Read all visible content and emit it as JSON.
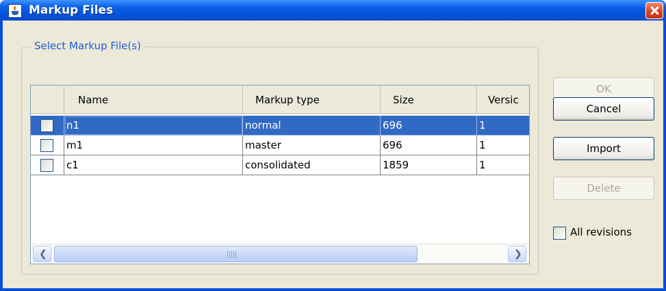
{
  "window": {
    "title": "Markup Files"
  },
  "group": {
    "title": "Select Markup File(s)"
  },
  "table": {
    "columns": [
      "",
      "Name",
      "Markup type",
      "Size",
      "Versic"
    ],
    "rows": [
      {
        "checked": false,
        "selected": true,
        "name": "n1",
        "markup_type": "normal",
        "size": "696",
        "version": "1"
      },
      {
        "checked": false,
        "selected": false,
        "name": "m1",
        "markup_type": "master",
        "size": "696",
        "version": "1"
      },
      {
        "checked": false,
        "selected": false,
        "name": "c1",
        "markup_type": "consolidated",
        "size": "1859",
        "version": "1"
      }
    ],
    "scroll_grip": "IIII"
  },
  "buttons": {
    "ok": "OK",
    "cancel": "Cancel",
    "import": "Import",
    "delete": "Delete"
  },
  "options": {
    "all_revisions_label": "All revisions",
    "all_revisions_checked": false
  },
  "colors": {
    "titlebar": "#0a5fe8",
    "selection": "#316ac5",
    "group_title": "#1f5fd6",
    "close_button": "#d6411f"
  },
  "icons": {
    "app": "java-cup-icon",
    "close": "close-icon",
    "scroll_left": "arrow-left-icon",
    "scroll_right": "arrow-right-icon"
  }
}
